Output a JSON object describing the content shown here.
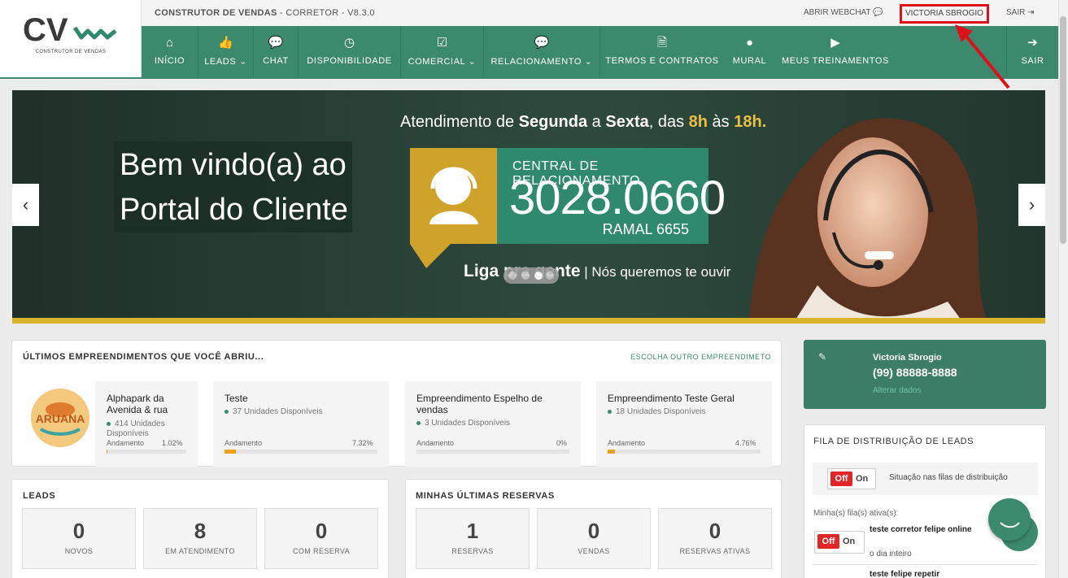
{
  "header": {
    "app_title": "CONSTRUTOR DE VENDAS",
    "app_role": " - CORRETOR - V8.3.0",
    "logo_text": "CV",
    "logo_sub": "CONSTRUTOR DE VENDAS",
    "webchat_label": "ABRIR WEBCHAT",
    "user_label": "VICTORIA SBROGIO",
    "logout_label": "SAIR"
  },
  "nav": {
    "items": [
      {
        "label": "INÍCIO"
      },
      {
        "label": "LEADS ⌄"
      },
      {
        "label": "CHAT"
      },
      {
        "label": "DISPONIBILIDADE"
      },
      {
        "label": "COMERCIAL ⌄"
      },
      {
        "label": "RELACIONAMENTO ⌄"
      },
      {
        "label": "TERMOS E CONTRATOS"
      },
      {
        "label": "MURAL"
      },
      {
        "label": "MEUS TREINAMENTOS"
      },
      {
        "label": "SAIR"
      }
    ]
  },
  "banner": {
    "welcome_line1": "Bem vindo(a) ao",
    "welcome_line2": "Portal do Cliente",
    "atend_pre": "Atendimento de ",
    "atend_d1": "Segunda",
    "atend_mid": " a ",
    "atend_d2": "Sexta",
    "atend_mid2": ", das ",
    "atend_h1": "8h",
    "atend_mid3": " às ",
    "atend_h2": "18h.",
    "central_title": "CENTRAL DE RELACIONAMENTO",
    "central_phone": "3028.0660",
    "central_ramal": "RAMAL 6655",
    "liga_bold": "Liga pra gente",
    "liga_rest": " | Nós queremos te ouvir",
    "prev_arrow": "‹",
    "next_arrow": "›"
  },
  "empreendimentos": {
    "title": "ÚLTIMOS EMPREENDIMENTOS QUE VOCÊ ABRIU...",
    "link": "ESCOLHA OUTRO EMPREENDIMETO",
    "progress_label": "Andamento",
    "logo_text": "ARUANA",
    "items": [
      {
        "name": "Alphapark da Avenida & rua",
        "units": "414 Unidades Disponíveis",
        "percent": "1.02%",
        "progress": 1.02
      },
      {
        "name": "Teste",
        "units": "37 Unidades Disponíveis",
        "percent": "7.32%",
        "progress": 7.32
      },
      {
        "name": "Empreendimento Espelho de vendas",
        "units": "3 Unidades Disponíveis",
        "percent": "0%",
        "progress": 0
      },
      {
        "name": "Empreendimento Teste Geral",
        "units": "18 Unidades Disponíveis",
        "percent": "4.76%",
        "progress": 4.76
      }
    ]
  },
  "leads": {
    "title": "LEADS",
    "stats": [
      {
        "value": "0",
        "label": "NOVOS"
      },
      {
        "value": "8",
        "label": "EM ATENDIMENTO"
      },
      {
        "value": "0",
        "label": "COM RESERVA"
      }
    ]
  },
  "reservas": {
    "title": "MINHAS ÚLTIMAS RESERVAS",
    "stats": [
      {
        "value": "1",
        "label": "RESERVAS"
      },
      {
        "value": "0",
        "label": "VENDAS"
      },
      {
        "value": "0",
        "label": "RESERVAS ATIVAS"
      }
    ]
  },
  "user_card": {
    "name": "Victoria Sbrogio",
    "phone": "(99) 88888-8888",
    "edit_link": "Alterar dados"
  },
  "fila": {
    "title": "FILA DE DISTRIBUIÇÃO DE LEADS",
    "toggle_off": "Off",
    "toggle_on": "On",
    "situacao": "Situação nas filas de distribuição",
    "ativas_label": "Minha(s) fila(s) ativa(s):",
    "queue1_name": "teste corretor felipe online",
    "queue1_sub": "o dia inteiro",
    "queue2_name": "teste felipe repetir"
  },
  "colors": {
    "brand_green": "#3c8a6e",
    "annotation_red": "#e0101a",
    "banner_gold": "#d9b52a"
  }
}
